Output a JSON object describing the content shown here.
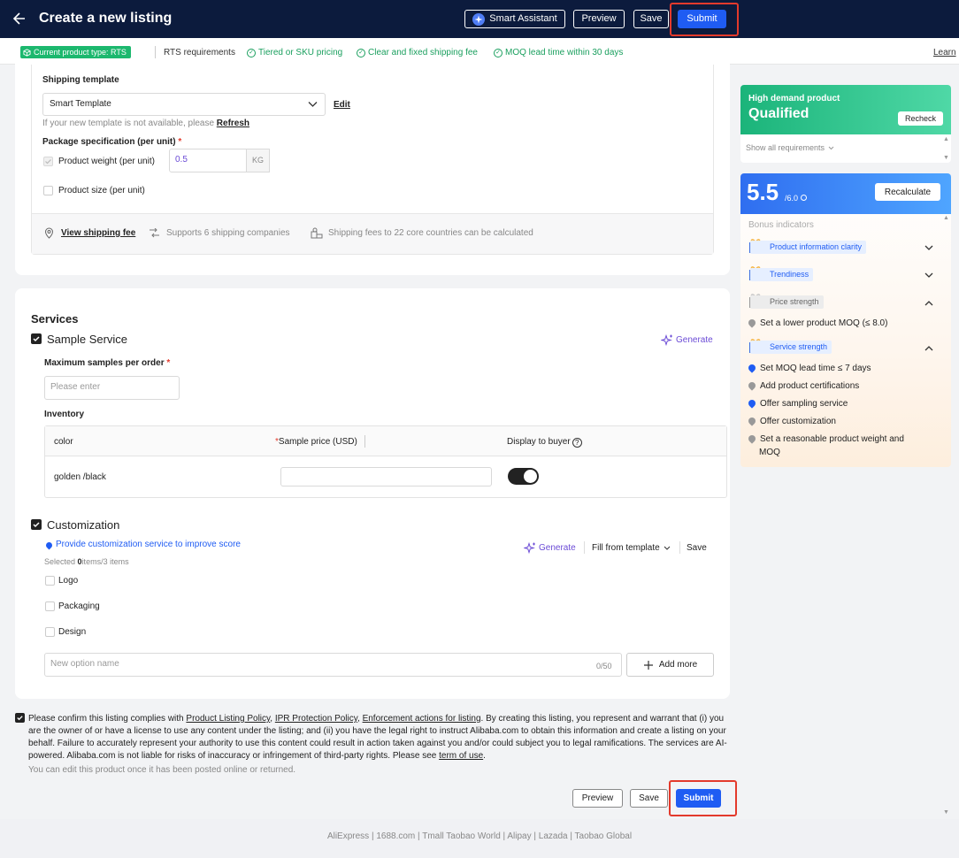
{
  "header": {
    "title": "Create a new listing",
    "smart_assistant": "Smart Assistant",
    "preview": "Preview",
    "save": "Save",
    "submit": "Submit"
  },
  "req_bar": {
    "product_type": "Current product type: RTS",
    "rts_requirements": "RTS requirements",
    "req1": "Tiered or SKU pricing",
    "req2": "Clear and fixed shipping fee",
    "req3": "MOQ lead time within 30 days",
    "learn": "Learn"
  },
  "shipping": {
    "template_label": "Shipping template",
    "template_value": "Smart Template",
    "edit": "Edit",
    "not_available": "If your new template is not available, please",
    "refresh": "Refresh",
    "package_spec": "Package specification (per unit)",
    "weight_label": "Product weight (per unit)",
    "weight_value": "0.5",
    "weight_unit": "KG",
    "size_label": "Product size (per unit)",
    "view_fee": "View shipping fee",
    "companies": "Supports 6 shipping companies",
    "countries": "Shipping fees to 22 core countries can be calculated"
  },
  "services": {
    "title": "Services",
    "sample_service": "Sample Service",
    "generate": "Generate",
    "max_samples_label": "Maximum samples per order",
    "max_samples_placeholder": "Please enter",
    "inventory_label": "Inventory",
    "table_headers": {
      "color": "color",
      "sample_price": "Sample price (USD)",
      "display": "Display to buyer"
    },
    "row_color": "golden /black"
  },
  "customization": {
    "title": "Customization",
    "hint": "Provide customization service to improve score",
    "selected_prefix": "Selected",
    "selected_count": "0",
    "selected_suffix": "items/3 items",
    "generate": "Generate",
    "fill_template": "Fill from template",
    "save": "Save",
    "options": [
      "Logo",
      "Packaging",
      "Design"
    ],
    "new_option_placeholder": "New option name",
    "counter": "0/50",
    "add_more": "Add more"
  },
  "consent": {
    "prefix": "Please confirm this listing complies with ",
    "link1": "Product Listing Policy",
    ",": ",",
    "link2": "IPR Protection Policy",
    "link3": "Enforcement actions for listing",
    "body": ". By creating this listing, you represent and warrant that (i) you are the owner of or have a license to use any content under the listing; and (ii) you have the legal right to instruct Alibaba.com to obtain this information and create a listing on your behalf. Failure to accurately represent your authority to use this content could result in action taken against you and/or could subject you to legal ramifications. The services are AI-powered. Alibaba.com is not liable for risks of inaccuracy or infringement of third-party rights. Please see ",
    "link4": "term of use",
    "end": ".",
    "note": "You can edit this product once it has been posted online or returned."
  },
  "bottom_buttons": {
    "preview": "Preview",
    "save": "Save",
    "submit": "Submit"
  },
  "side": {
    "demand_label": "High demand product",
    "demand_status": "Qualified",
    "recheck": "Recheck",
    "show_all": "Show all requirements",
    "score": "5.5",
    "score_max": "/6.0",
    "recalculate": "Recalculate",
    "bonus": "Bonus indicators",
    "ind1": "Product information clarity",
    "ind2": "Trendiness",
    "ind3": "Price strength",
    "ind3_items": [
      "Set a lower product MOQ (≤ 8.0)"
    ],
    "ind4": "Service strength",
    "ind4_items": [
      "Set MOQ lead time ≤ 7 days",
      "Add product certifications",
      "Offer sampling service",
      "Offer customization",
      "Set a reasonable product weight and",
      "MOQ"
    ]
  },
  "footer": {
    "links": "AliExpress | 1688.com | Tmall Taobao World | Alipay | Lazada | Taobao Global"
  },
  "colors": {
    "header_bg": "#0c1b3d",
    "primary": "#1f5cf3",
    "success": "#1cb86e",
    "highlight": "#e33a2c"
  }
}
